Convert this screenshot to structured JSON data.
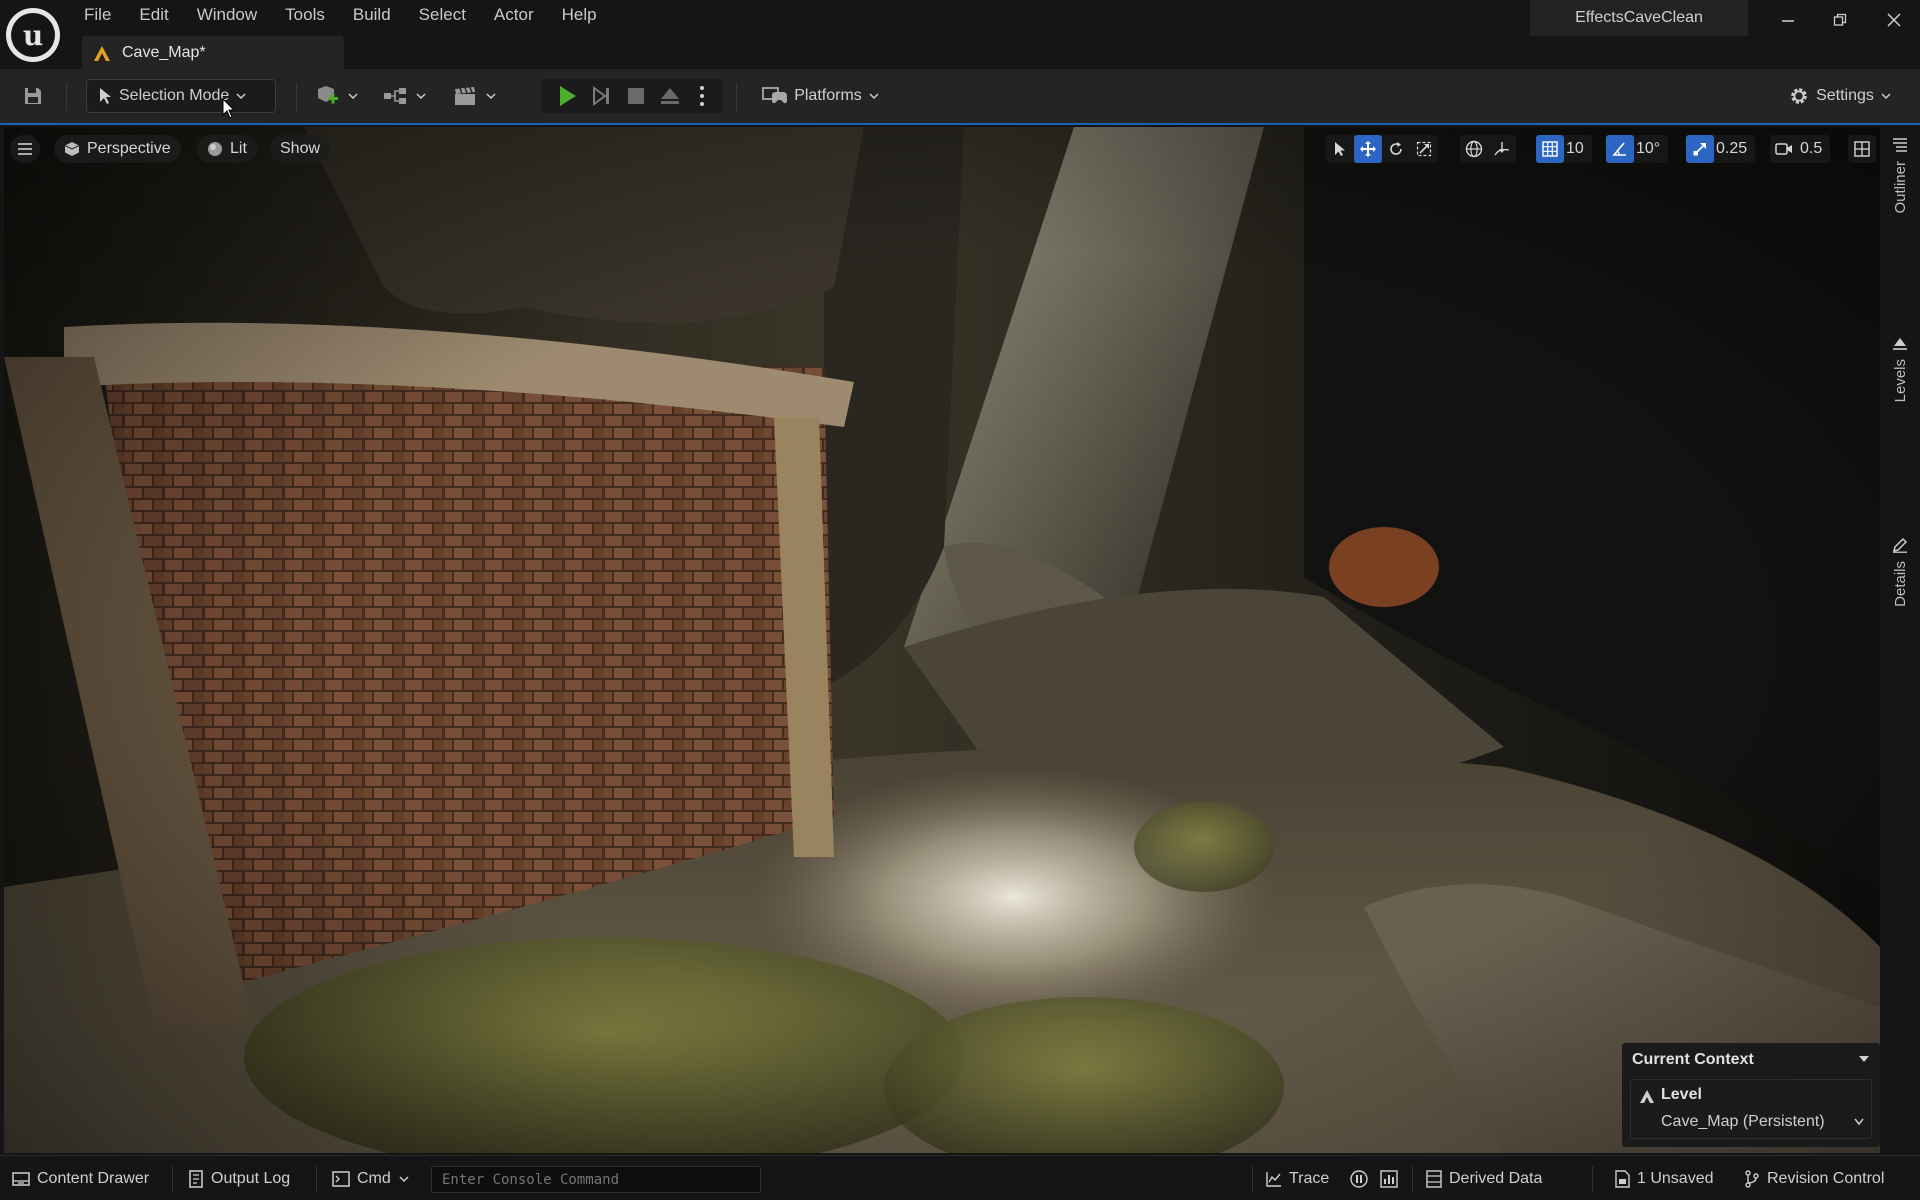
{
  "menu": [
    "File",
    "Edit",
    "Window",
    "Tools",
    "Build",
    "Select",
    "Actor",
    "Help"
  ],
  "document_tab": {
    "label": "Cave_Map*"
  },
  "project_name": "EffectsCaveClean",
  "toolbar": {
    "selection_mode": "Selection Mode",
    "platforms": "Platforms",
    "settings": "Settings"
  },
  "viewport": {
    "perspective": "Perspective",
    "lit": "Lit",
    "show": "Show",
    "grid_snap": "10",
    "rotation_snap": "10°",
    "scale_snap": "0.25",
    "camera_speed": "0.5"
  },
  "context_panel": {
    "title": "Current Context",
    "level_label": "Level",
    "map_value": "Cave_Map (Persistent)"
  },
  "side_tabs": [
    "Outliner",
    "Levels",
    "Details"
  ],
  "statusbar": {
    "content_drawer": "Content Drawer",
    "output_log": "Output Log",
    "cmd": "Cmd",
    "console_placeholder": "Enter Console Command",
    "trace": "Trace",
    "derived_data": "Derived Data",
    "unsaved": "1 Unsaved",
    "revision_control": "Revision Control"
  },
  "colors": {
    "accent": "#2d66c2",
    "play_green": "#4caf2a",
    "level_orange": "#e8a020"
  }
}
